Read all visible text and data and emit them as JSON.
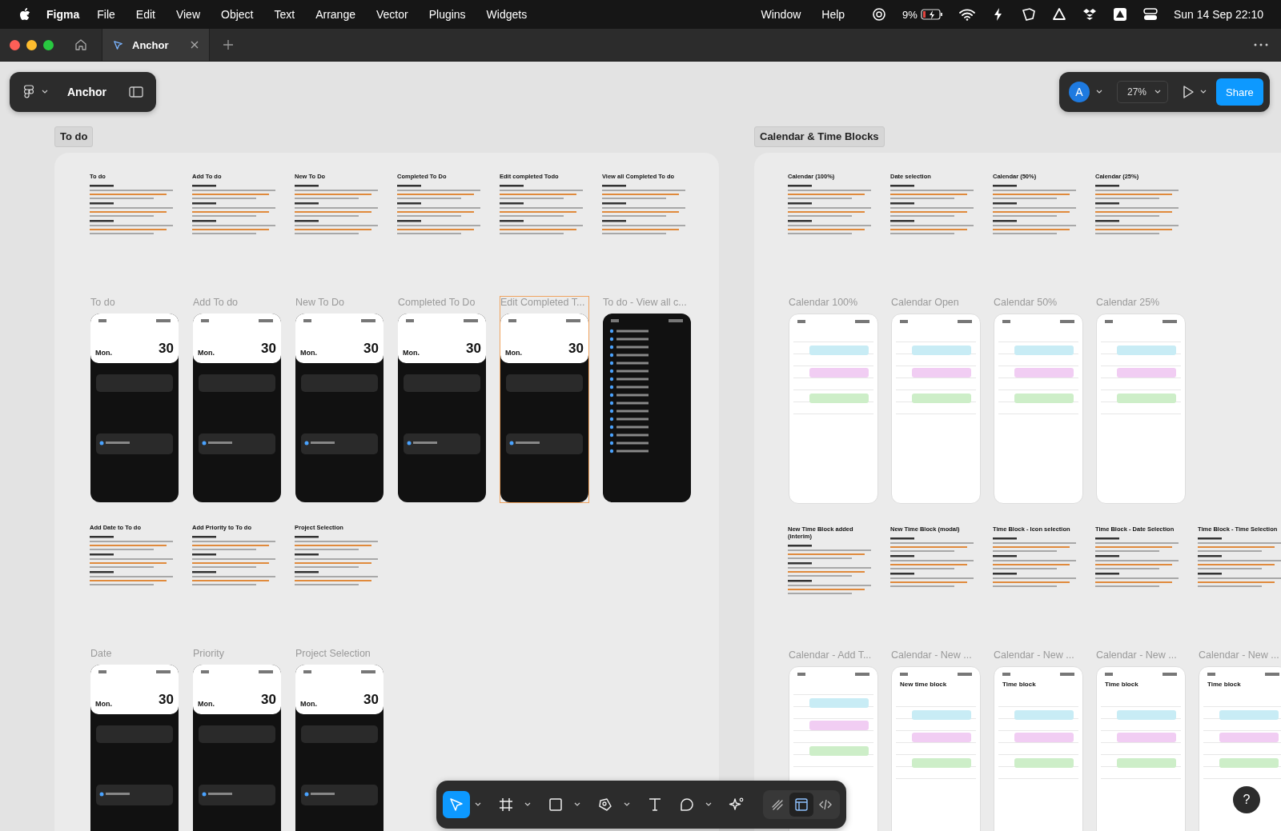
{
  "menubar": {
    "app": "Figma",
    "menus": [
      "File",
      "Edit",
      "View",
      "Object",
      "Text",
      "Arrange",
      "Vector",
      "Plugins",
      "Widgets"
    ],
    "right_menus": [
      "Window",
      "Help"
    ],
    "battery": "9%",
    "clock": "Sun 14 Sep 22:10"
  },
  "tabs": [
    {
      "label": "Anchor",
      "selected": true
    }
  ],
  "file_menu": {
    "name": "Anchor"
  },
  "top_right": {
    "avatar": "A",
    "zoom": "27%",
    "share": "Share"
  },
  "sections": [
    {
      "label": "To do",
      "groups": [
        {
          "frames": [
            {
              "doc_title": "To do",
              "label": "To do",
              "highlighted": false,
              "phone": {
                "kind": "header",
                "day": "Mon.",
                "date": "30"
              }
            },
            {
              "doc_title": "Add To do",
              "label": "Add To do",
              "highlighted": false,
              "phone": {
                "kind": "header",
                "day": "Mon.",
                "date": "30"
              }
            },
            {
              "doc_title": "New To Do",
              "label": "New To Do",
              "highlighted": false,
              "phone": {
                "kind": "header",
                "day": "Mon.",
                "date": "30"
              }
            },
            {
              "doc_title": "Completed To Do",
              "label": "Completed To Do",
              "highlighted": false,
              "phone": {
                "kind": "header",
                "day": "Mon.",
                "date": "30"
              }
            },
            {
              "doc_title": "Edit completed Todo",
              "label": "Edit Completed T...",
              "highlighted": true,
              "phone": {
                "kind": "header",
                "day": "Mon.",
                "date": "30"
              }
            },
            {
              "doc_title": "View all Completed To do",
              "label": "To do - View all c...",
              "highlighted": false,
              "phone": {
                "kind": "dark"
              }
            }
          ]
        },
        {
          "frames": [
            {
              "doc_title": "Add Date to To do",
              "label": "Date",
              "highlighted": false,
              "phone": {
                "kind": "header",
                "day": "Mon.",
                "date": "30"
              }
            },
            {
              "doc_title": "Add Priority to To do",
              "label": "Priority",
              "highlighted": false,
              "phone": {
                "kind": "header",
                "day": "Mon.",
                "date": "30"
              }
            },
            {
              "doc_title": "Project Selection",
              "label": "Project Selection",
              "highlighted": false,
              "phone": {
                "kind": "header",
                "day": "Mon.",
                "date": "30"
              }
            }
          ]
        }
      ]
    },
    {
      "label": "Calendar & Time Blocks",
      "groups": [
        {
          "frames": [
            {
              "doc_title": "Calendar (100%)",
              "label": "Calendar 100%",
              "highlighted": false,
              "phone": {
                "kind": "light"
              }
            },
            {
              "doc_title": "Date selection",
              "label": "Calendar Open",
              "highlighted": false,
              "phone": {
                "kind": "light"
              }
            },
            {
              "doc_title": "Calendar (50%)",
              "label": "Calendar 50%",
              "highlighted": false,
              "phone": {
                "kind": "light"
              }
            },
            {
              "doc_title": "Calendar (25%)",
              "label": "Calendar 25%",
              "highlighted": false,
              "phone": {
                "kind": "light"
              }
            }
          ]
        },
        {
          "frames": [
            {
              "doc_title": "New Time Block added (interim)",
              "label": "Calendar - Add T...",
              "highlighted": false,
              "phone": {
                "kind": "light"
              }
            },
            {
              "doc_title": "New Time Block (modal)",
              "label": "Calendar - New ...",
              "highlighted": false,
              "phone": {
                "kind": "light",
                "title": "New time block"
              }
            },
            {
              "doc_title": "Time Block - Icon selection",
              "label": "Calendar - New ...",
              "highlighted": false,
              "phone": {
                "kind": "light",
                "title": "Time block"
              }
            },
            {
              "doc_title": "Time Block - Date Selection",
              "label": "Calendar - New ...",
              "highlighted": false,
              "phone": {
                "kind": "light",
                "title": "Time block"
              }
            },
            {
              "doc_title": "Time Block - Time Selection",
              "label": "Calendar - New ...",
              "highlighted": false,
              "phone": {
                "kind": "light",
                "title": "Time block"
              }
            }
          ]
        }
      ]
    }
  ],
  "toolbar": {
    "tools": [
      {
        "kind": "move",
        "selected": true,
        "caret": true
      },
      {
        "kind": "frame",
        "selected": false,
        "caret": true
      },
      {
        "kind": "shape",
        "selected": false,
        "caret": true
      },
      {
        "kind": "pen",
        "selected": false,
        "caret": true
      },
      {
        "kind": "text",
        "selected": false,
        "caret": false
      },
      {
        "kind": "comment",
        "selected": false,
        "caret": true
      },
      {
        "kind": "ai",
        "selected": false,
        "caret": false
      }
    ],
    "modes": [
      {
        "kind": "draw",
        "selected": false
      },
      {
        "kind": "design",
        "selected": true
      },
      {
        "kind": "code",
        "selected": false
      }
    ]
  },
  "help": "?"
}
